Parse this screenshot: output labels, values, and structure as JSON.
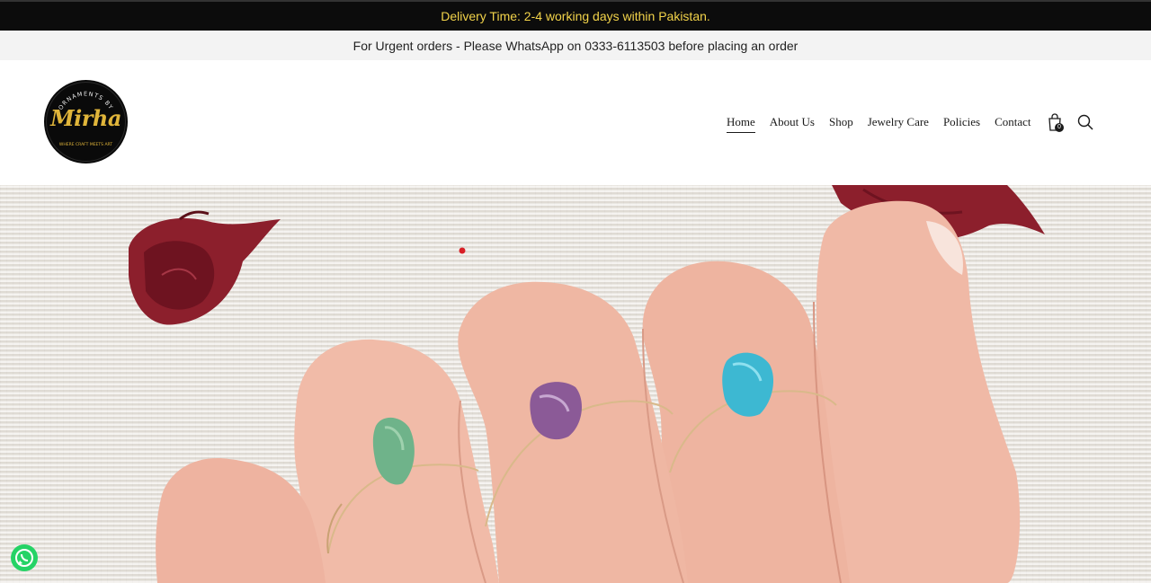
{
  "announcement": {
    "delivery_text": "Delivery Time: 2-4 working days within Pakistan.",
    "urgent_text": "For Urgent orders - Please WhatsApp on 0333-6113503 before placing an order"
  },
  "logo": {
    "arc_text": "ORNAMENTS BY",
    "script_text": "Mirha",
    "tagline": "WHERE CRAFT MEETS ART"
  },
  "nav": {
    "items": [
      {
        "label": "Home",
        "active": true
      },
      {
        "label": "About Us",
        "active": false
      },
      {
        "label": "Shop",
        "active": false
      },
      {
        "label": "Jewelry Care",
        "active": false
      },
      {
        "label": "Policies",
        "active": false
      },
      {
        "label": "Contact",
        "active": false
      }
    ]
  },
  "cart": {
    "icon": "shopping-bag-icon",
    "count": "0"
  },
  "search": {
    "icon": "search-icon"
  },
  "floating": {
    "whatsapp_icon": "whatsapp-icon"
  },
  "colors": {
    "announce_bg": "#0c0c0c",
    "announce_text": "#f2d34a",
    "sub_bg": "#f3f3f3",
    "logo_gold": "#e0b53a",
    "whatsapp_green": "#25d366"
  }
}
